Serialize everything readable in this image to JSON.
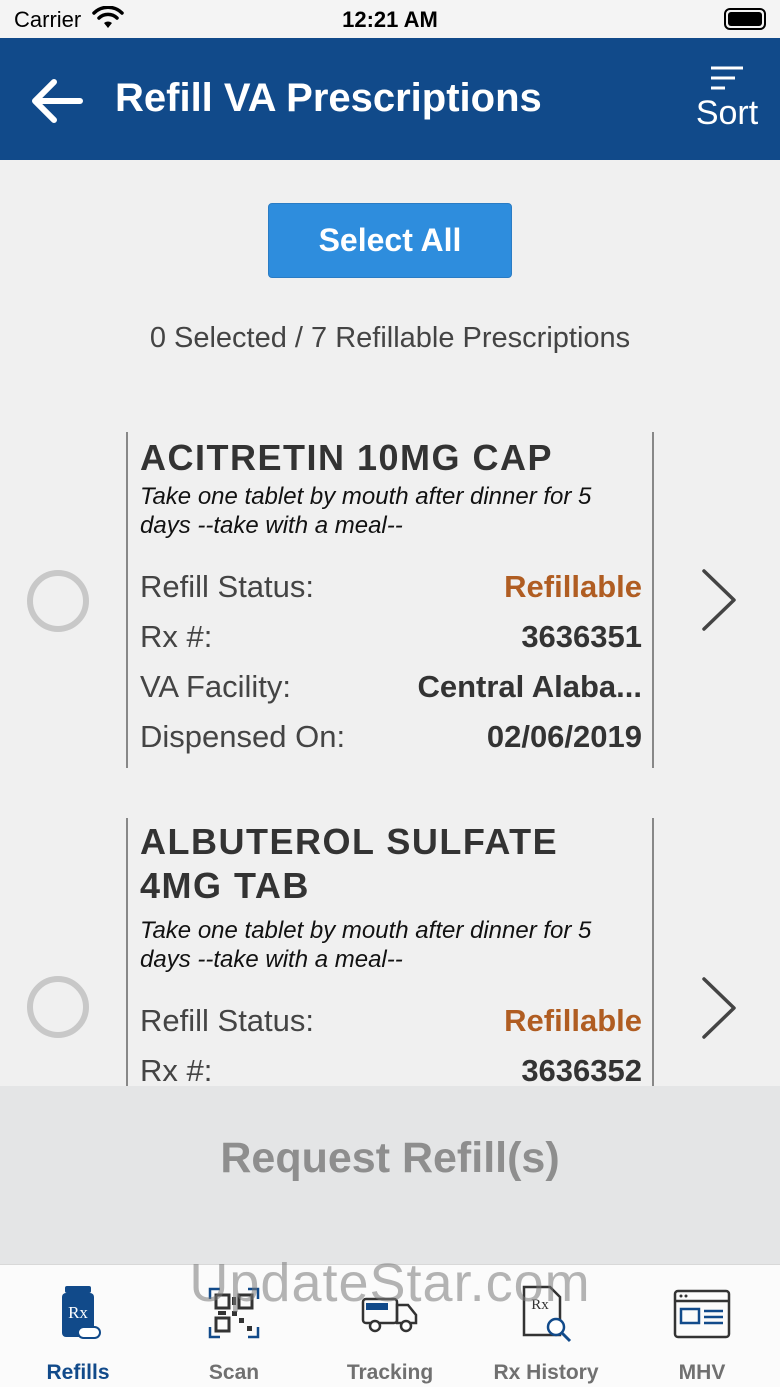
{
  "status_bar": {
    "carrier": "Carrier",
    "time": "12:21 AM"
  },
  "header": {
    "title": "Refill VA Prescriptions",
    "sort_label": "Sort"
  },
  "select_all_label": "Select All",
  "selection_counter": "0 Selected / 7 Refillable Prescriptions",
  "prescriptions": [
    {
      "name": "ACITRETIN 10MG CAP",
      "instructions": "Take one tablet by mouth after dinner for 5 days --take with a meal--",
      "status_label": "Refill Status:",
      "status": "Refillable",
      "rx_label": "Rx #:",
      "rx_number": "3636351",
      "facility_label": "VA Facility:",
      "facility": "Central Alaba...",
      "dispensed_label": "Dispensed On:",
      "dispensed": "02/06/2019"
    },
    {
      "name": "ALBUTEROL SULFATE 4MG TAB",
      "instructions": "Take one tablet by mouth after dinner for 5 days --take with a meal--",
      "status_label": "Refill Status:",
      "status": "Refillable",
      "rx_label": "Rx #:",
      "rx_number": "3636352"
    }
  ],
  "request_refill_label": "Request Refill(s)",
  "tabs": [
    {
      "label": "Refills",
      "icon": "pill-bottle-icon",
      "active": true
    },
    {
      "label": "Scan",
      "icon": "qr-code-icon"
    },
    {
      "label": "Tracking",
      "icon": "delivery-truck-icon"
    },
    {
      "label": "Rx History",
      "icon": "rx-document-search-icon"
    },
    {
      "label": "MHV",
      "icon": "browser-window-icon"
    }
  ],
  "watermark": "UpdateStar.com",
  "colors": {
    "header": "#114a8a",
    "button": "#2e8ddd",
    "status": "#b05d22"
  }
}
